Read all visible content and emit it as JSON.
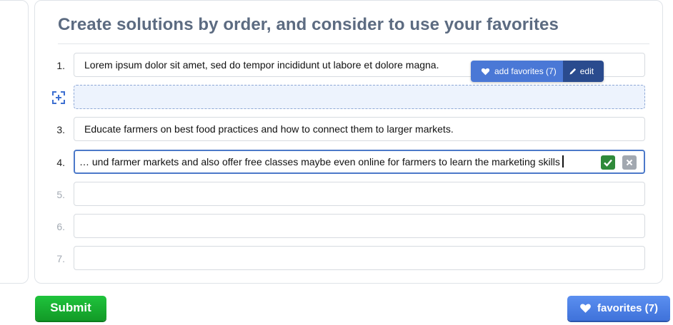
{
  "heading": "Create solutions by order, and consider to use your favorites",
  "rows": [
    {
      "number": "1.",
      "value": "Lorem ipsum dolor sit amet, sed do tempor incididunt ut labore et dolore magna."
    },
    {
      "number": "",
      "value": ""
    },
    {
      "number": "3.",
      "value": "Educate farmers on best food practices and how to connect them to larger markets."
    },
    {
      "number": "4.",
      "value": "… und farmer markets and also offer free classes maybe even online for farmers to learn the marketing skills"
    },
    {
      "number": "5.",
      "value": ""
    },
    {
      "number": "6.",
      "value": ""
    },
    {
      "number": "7.",
      "value": ""
    }
  ],
  "popover": {
    "add_favorites_label": "add favorites (7)",
    "edit_label": "edit"
  },
  "buttons": {
    "submit_label": "Submit",
    "favorites_label": "favorites (7)"
  },
  "colors": {
    "title": "#5c6b81",
    "submit": "#1fc43c",
    "favorites": "#4a78d6",
    "confirm": "#2f8a3a",
    "drop_zone": "#edf3fd"
  }
}
